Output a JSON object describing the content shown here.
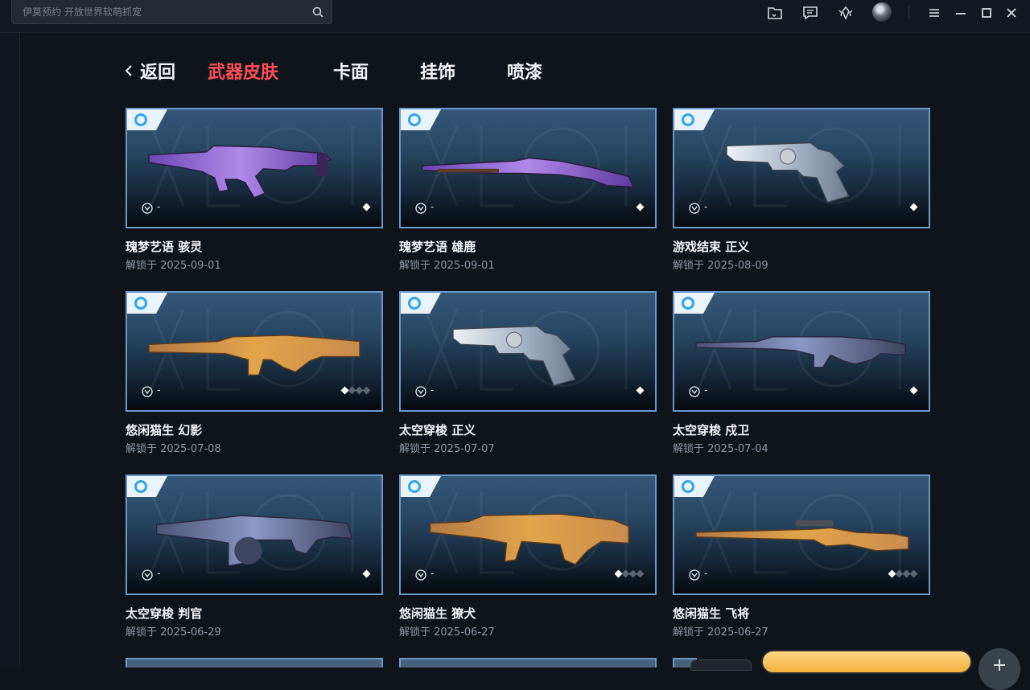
{
  "search": {
    "placeholder": "伊莫预约 开放世界软萌抓宠",
    "icon": "search-icon"
  },
  "toolbar": {
    "icons": [
      "folder-icon",
      "message-icon",
      "radiant-points-icon",
      "avatar",
      "menu-icon",
      "minimize-icon",
      "maximize-icon",
      "close-icon"
    ]
  },
  "nav": {
    "back_label": "返回",
    "tabs": [
      {
        "label": "武器皮肤",
        "active": true
      },
      {
        "label": "卡面",
        "active": false
      },
      {
        "label": "挂饰",
        "active": false
      },
      {
        "label": "喷漆",
        "active": false
      }
    ]
  },
  "cards": [
    {
      "name": "瑰梦艺语 骇灵",
      "date": "解锁于 2025-09-01",
      "price": "-",
      "levels": 1,
      "weapon": "smg"
    },
    {
      "name": "瑰梦艺语 雄鹿",
      "date": "解锁于 2025-09-01",
      "price": "-",
      "levels": 1,
      "weapon": "shotgun"
    },
    {
      "name": "游戏结束 正义",
      "date": "解锁于 2025-08-09",
      "price": "-",
      "levels": 1,
      "weapon": "revolver"
    },
    {
      "name": "悠闲猫生 幻影",
      "date": "解锁于 2025-07-08",
      "price": "-",
      "levels": 4,
      "weapon": "rifle"
    },
    {
      "name": "太空穿梭 正义",
      "date": "解锁于 2025-07-07",
      "price": "-",
      "levels": 1,
      "weapon": "revolver"
    },
    {
      "name": "太空穿梭 戍卫",
      "date": "解锁于 2025-07-04",
      "price": "-",
      "levels": 1,
      "weapon": "dmr"
    },
    {
      "name": "太空穿梭 判官",
      "date": "解锁于 2025-06-29",
      "price": "-",
      "levels": 1,
      "weapon": "judge"
    },
    {
      "name": "悠闲猫生 獠犬",
      "date": "解锁于 2025-06-27",
      "price": "-",
      "levels": 4,
      "weapon": "bulldog"
    },
    {
      "name": "悠闲猫生 飞将",
      "date": "解锁于 2025-06-27",
      "price": "-",
      "levels": 4,
      "weapon": "marshal"
    }
  ],
  "colors": {
    "accent_active_tab": "#ff4e58",
    "card_border": "#6e97c8",
    "tier_ring": "#31a4ec",
    "cta": "#f2b13c"
  }
}
